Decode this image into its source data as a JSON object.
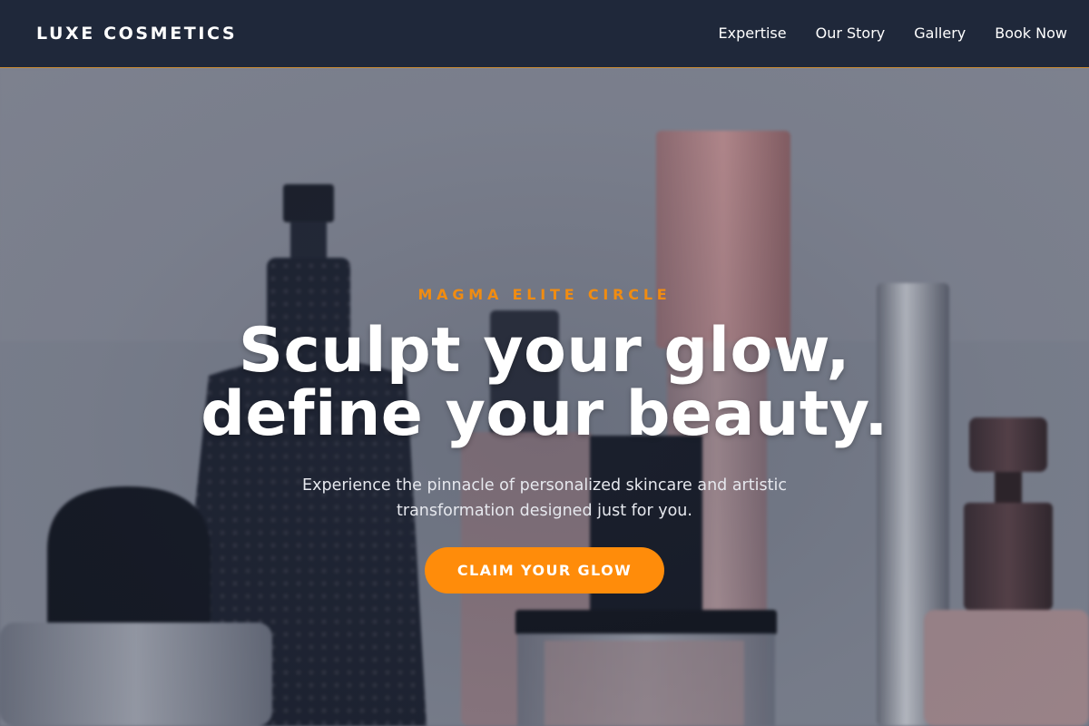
{
  "nav": {
    "brand": "LUXE COSMETICS",
    "links": [
      "Expertise",
      "Our Story",
      "Gallery",
      "Book Now"
    ]
  },
  "hero": {
    "eyebrow": "MAGMA ELITE CIRCLE",
    "headline_line1": "Sculpt your glow,",
    "headline_line2": "define your beauty.",
    "subtext_line1": "Experience the pinnacle of personalized skincare and artistic",
    "subtext_line2": "transformation designed just for you.",
    "cta_label": "CLAIM YOUR GLOW",
    "background_image": "blurred cosmetic bottles"
  },
  "colors": {
    "navbar_bg": "#1f283a",
    "accent": "#ff8c0a",
    "eyebrow": "#f08c12",
    "text_light": "#ffffff"
  }
}
